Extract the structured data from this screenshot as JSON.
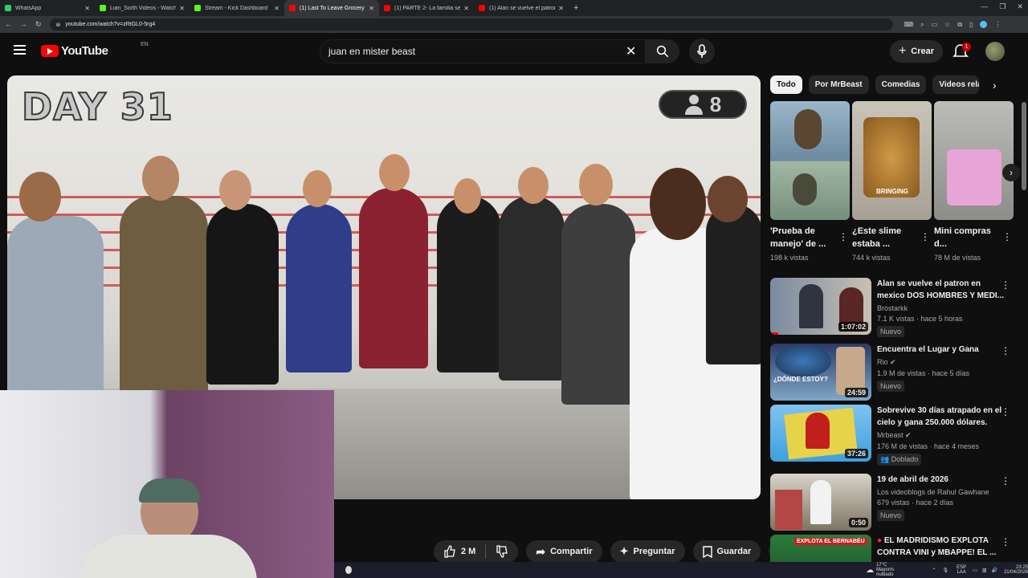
{
  "browser": {
    "tabs": [
      {
        "label": "WhatsApp",
        "color": "#25d366",
        "active": false
      },
      {
        "label": "Lian_Sorth Videos - Watch",
        "color": "#53fc18",
        "active": false
      },
      {
        "label": "Stream - Kick Dashboard",
        "color": "#53fc18",
        "active": false
      },
      {
        "label": "(1) Last To Leave Grocery S",
        "color": "#ff0000",
        "active": true
      },
      {
        "label": "(1) PARTE 2- La familia se c",
        "color": "#ff0000",
        "active": false
      },
      {
        "label": "(1) Alan se vuelve el patron en",
        "color": "#ff0000",
        "active": false
      }
    ],
    "url": "youtube.com/watch?v=zRtGL0-5rg4"
  },
  "header": {
    "logo_text": "YouTube",
    "country": "EN",
    "search_value": "juan en mister beast",
    "create_label": "Crear",
    "notifications": "1"
  },
  "player": {
    "overlay_day": "DAY 31",
    "overlay_count": "8"
  },
  "actions": {
    "likes": "2 M",
    "share": "Compartir",
    "ask": "Preguntar",
    "save": "Guardar"
  },
  "chips": [
    "Todo",
    "Por MrBeast",
    "Comedias",
    "Videos rela"
  ],
  "shorts": [
    {
      "title": "'Prueba de manejo' de ...",
      "views": "198 k vistas"
    },
    {
      "title": "¿Este slime estaba ...",
      "views": "744 k vistas",
      "thumb_text": "BRINGING"
    },
    {
      "title": "Mini compras d...",
      "views": "78 M de vistas"
    }
  ],
  "recs": [
    {
      "title": "Alan se vuelve el patron en mexico DOS HOMBRES Y MEDI...",
      "channel": "Brostarkk",
      "meta": "7.1 K vistas · hace 5 horas",
      "badge": "Nuevo",
      "duration": "1:07:02"
    },
    {
      "title": "Encuentra el Lugar y Gana",
      "channel": "Rio",
      "meta": "1.9 M de vistas · hace 5 días",
      "badge": "Nuevo",
      "duration": "24:59",
      "thumb_text": "¿DÓNDE ESTOY?"
    },
    {
      "title": "Sobrevive 30 días atrapado en el cielo y gana 250.000 dólares.",
      "channel": "Mrbeast",
      "meta": "176 M de vistas · hace 4 meses",
      "badge": "Doblado",
      "duration": "37:26"
    },
    {
      "title": "19 de abril de 2026",
      "channel": "Los videoblogs de Rahul Gawhane",
      "meta": "679 vistas · hace 2 días",
      "badge": "Nuevo",
      "duration": "0:50"
    },
    {
      "title": "EL MADRIDISMO EXPLOTA CONTRA VINI y MBAPPE! EL ...",
      "channel": "",
      "meta": "",
      "badge": "",
      "duration": "",
      "thumb_text": "EXPLOTA EL BERNABÉU"
    }
  ],
  "taskbar": {
    "weather": "17°C",
    "weather_desc": "Mayorm. nublado",
    "lang": "ESP",
    "lang2": "LAA",
    "time": "23:25",
    "date": "21/04/2026"
  }
}
